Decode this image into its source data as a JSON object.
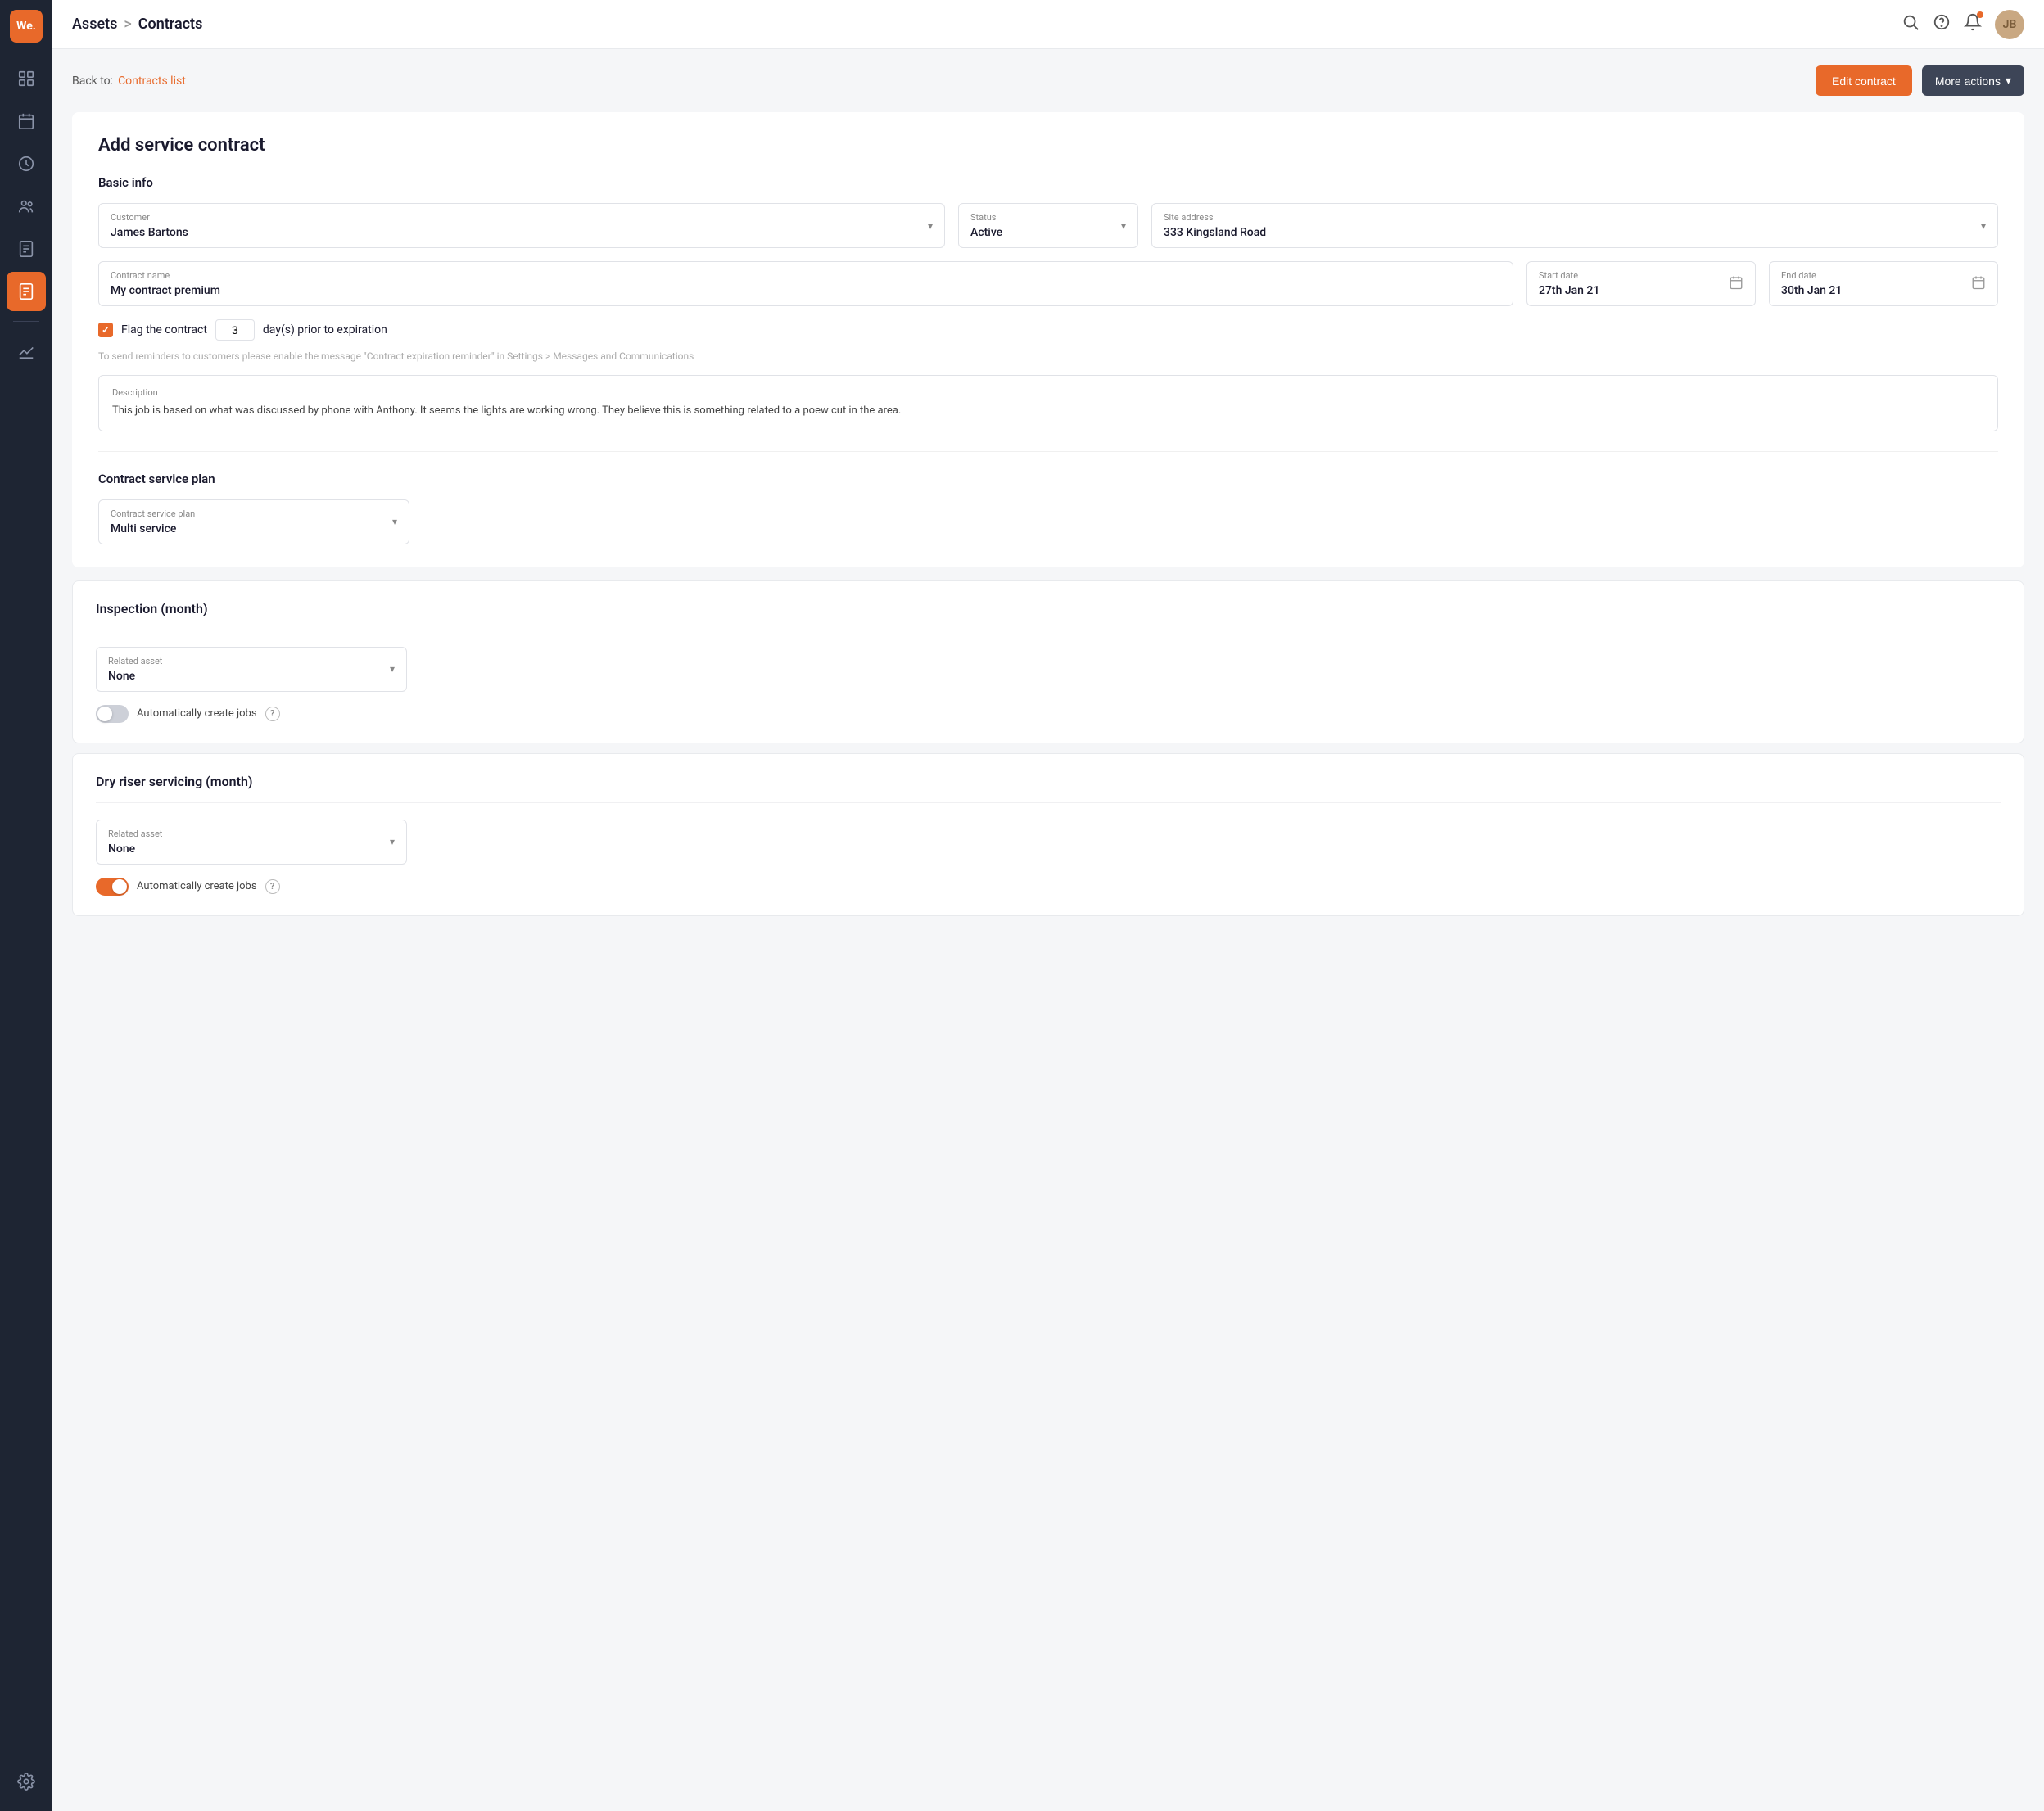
{
  "app": {
    "logo": "We.",
    "logo_bg": "#e8692a"
  },
  "sidebar": {
    "items": [
      {
        "id": "dashboard",
        "icon": "⊞",
        "active": false
      },
      {
        "id": "calendar",
        "icon": "▦",
        "active": false
      },
      {
        "id": "clock",
        "icon": "◷",
        "active": false
      },
      {
        "id": "contacts",
        "icon": "👤",
        "active": false
      },
      {
        "id": "documents",
        "icon": "📋",
        "active": false
      },
      {
        "id": "contracts",
        "icon": "🗒",
        "active": true
      },
      {
        "id": "reports",
        "icon": "📊",
        "active": false
      }
    ],
    "bottom_items": [
      {
        "id": "settings",
        "icon": "⚙"
      }
    ]
  },
  "header": {
    "breadcrumb_parent": "Assets",
    "breadcrumb_separator": ">",
    "breadcrumb_current": "Contracts"
  },
  "sub_header": {
    "back_prefix": "Back to:",
    "back_link": "Contracts list",
    "edit_button": "Edit contract",
    "more_button": "More actions"
  },
  "form": {
    "title": "Add service contract",
    "basic_info_label": "Basic info",
    "customer_label": "Customer",
    "customer_value": "James Bartons",
    "status_label": "Status",
    "status_value": "Active",
    "site_address_label": "Site address",
    "site_address_value": "333 Kingsland Road",
    "contract_name_label": "Contract name",
    "contract_name_value": "My contract premium",
    "start_date_label": "Start date",
    "start_date_value": "27th Jan 21",
    "end_date_label": "End date",
    "end_date_value": "30th Jan 21",
    "flag_label": "Flag the contract",
    "flag_days": "3",
    "flag_days_suffix": "day(s) prior to expiration",
    "reminder_text": "To send reminders to customers please enable the message \"Contract expiration reminder\" in Settings > Messages and Communications",
    "description_label": "Description",
    "description_text": "This job is based on what was discussed by phone with Anthony. It seems the lights are working wrong. They believe this is something related to a poew cut in the area.",
    "service_plan_section_title": "Contract service plan",
    "service_plan_label": "Contract service plan",
    "service_plan_value": "Multi service",
    "inspection_title": "Inspection (month)",
    "inspection_related_asset_label": "Related asset",
    "inspection_related_asset_value": "None",
    "inspection_auto_jobs_label": "Automatically create jobs",
    "inspection_auto_jobs_on": false,
    "dry_riser_title": "Dry riser servicing (month)",
    "dry_riser_related_asset_label": "Related asset",
    "dry_riser_related_asset_value": "None",
    "dry_riser_auto_jobs_label": "Automatically create jobs",
    "dry_riser_auto_jobs_on": true
  }
}
